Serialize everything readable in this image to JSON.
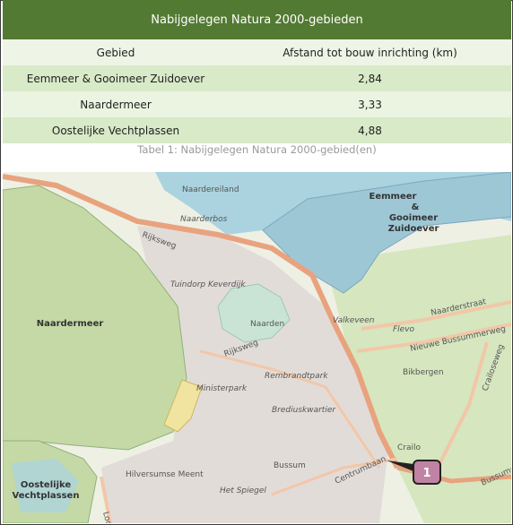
{
  "table": {
    "title": "Nabijgelegen Natura 2000-gebieden",
    "headers": [
      "Gebied",
      "Afstand tot bouw inrichting (km)"
    ],
    "rows": [
      {
        "gebied": "Eemmeer & Gooimeer Zuidoever",
        "afstand": "2,84"
      },
      {
        "gebied": "Naardermeer",
        "afstand": "3,33"
      },
      {
        "gebied": "Oostelijke Vechtplassen",
        "afstand": "4,88"
      }
    ],
    "caption": "Tabel 1: Nabijgelegen Natura 2000-gebied(en)"
  },
  "map": {
    "area_labels": {
      "eemmeer_1": "Eemmeer",
      "eemmeer_2": "&",
      "eemmeer_3": "Gooimeer",
      "eemmeer_4": "Zuidoever",
      "naardermeer": "Naardermeer",
      "oostelijke_1": "Oostelijke",
      "oostelijke_2": "Vechtplassen"
    },
    "place_labels": {
      "naardereiland": "Naardereiland",
      "naarderbos": "Naarderbos",
      "tuindorp": "Tuindorp Keverdijk",
      "naarden": "Naarden",
      "valkeveen": "Valkeveen",
      "flevo": "Flevo",
      "naarderstraat": "Naarderstraat",
      "nieuwe_bussum": "Nieuwe Bussummerweg",
      "bikbergen": "Bikbergen",
      "rembrandtpark": "Rembrandtpark",
      "ministerpark": "Ministerpark",
      "brediuskwartier": "Brediuskwartier",
      "crailo": "Crailo",
      "bussum": "Bussum",
      "hilversumse_meent": "Hilversumse Meent",
      "het_spiegel": "Het Spiegel",
      "rijksweg_1": "Rijksweg",
      "rijksweg_2": "Rijksweg",
      "centrumbaan": "Centrumbaan",
      "loosdrecht": "Loosdr",
      "crailoseweg": "Crailoseweg",
      "bussumerweg": "Bussumerweg"
    },
    "marker_label": "1",
    "colors": {
      "water": "#aad3df",
      "natura_green": "#c5d9a6",
      "urban": "#e2dcd9",
      "road_major": "#e8a37e",
      "marker": "#c083a4"
    }
  }
}
